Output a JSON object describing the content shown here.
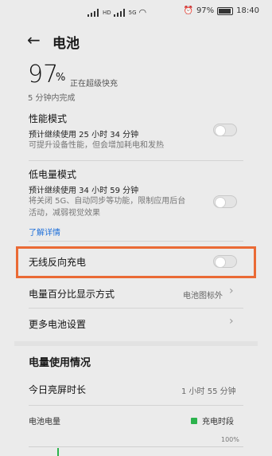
{
  "status_bar": {
    "signal_labels": [
      "HD",
      "5G"
    ],
    "battery_pct": "97%",
    "time": "18:40"
  },
  "header": {
    "back_icon": "arrow-left-icon",
    "title": "电池"
  },
  "battery": {
    "percent": "97",
    "unit": "%",
    "status": "正在超级快充",
    "time_remaining": "5 分钟内完成",
    "level": 97
  },
  "performance_mode": {
    "title": "性能模式",
    "sub": "预计继续使用 25 小时 34 分钟",
    "desc": "可提升设备性能，但会增加耗电和发热",
    "enabled": false
  },
  "low_power_mode": {
    "title": "低电量模式",
    "sub": "预计继续使用 34 小时 59 分钟",
    "desc_line1": "将关闭 5G、自动同步等功能，限制应用后台",
    "desc_line2": "活动，减弱视觉效果",
    "enabled": false
  },
  "learn_more": "了解详情",
  "wireless_reverse": {
    "title": "无线反向充电",
    "enabled": false
  },
  "battery_display": {
    "title": "电量百分比显示方式",
    "value": "电池图标外"
  },
  "more_settings": {
    "title": "更多电池设置"
  },
  "usage": {
    "section_title": "电量使用情况",
    "screen_time_label": "今日亮屏时长",
    "screen_time_value": "1 小时 55 分钟",
    "chart_label": "电池电量",
    "legend_charging": "充电时段",
    "axis_max": "100%",
    "legend_color": "#2cb34d"
  }
}
